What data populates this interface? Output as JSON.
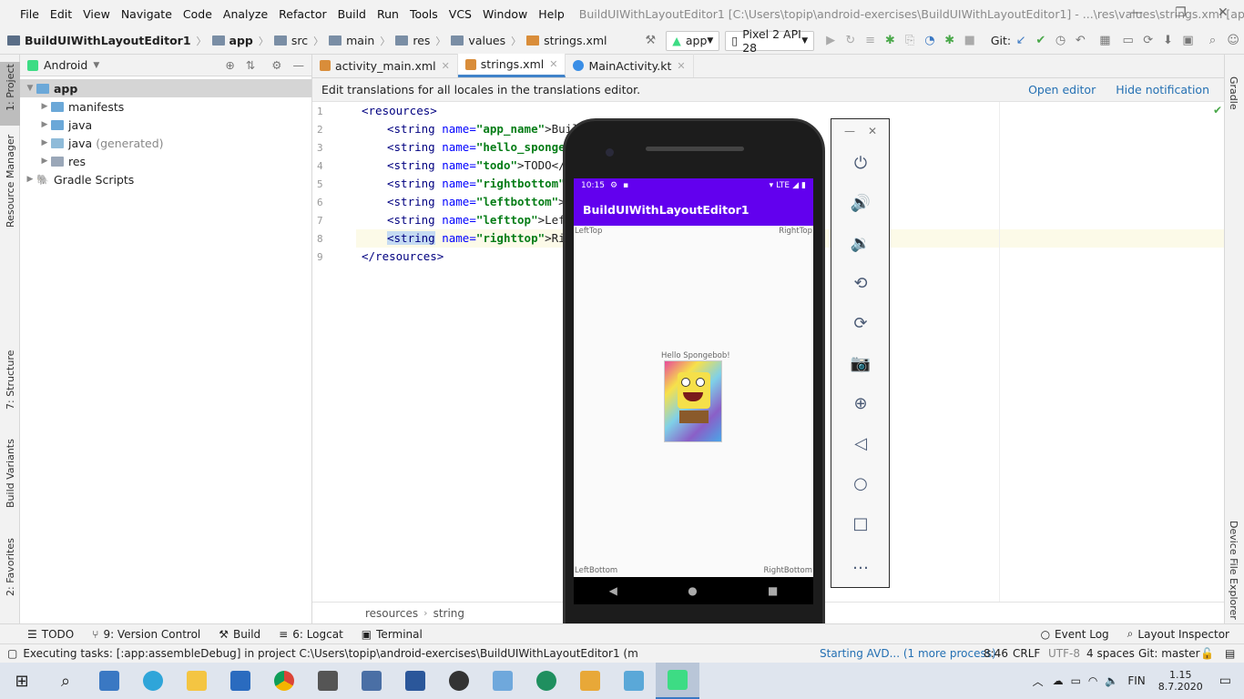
{
  "menubar": {
    "items": [
      "File",
      "Edit",
      "View",
      "Navigate",
      "Code",
      "Analyze",
      "Refactor",
      "Build",
      "Run",
      "Tools",
      "VCS",
      "Window",
      "Help"
    ],
    "window_title": "BuildUIWithLayoutEditor1 [C:\\Users\\topip\\android-exercises\\BuildUIWithLayoutEditor1] - ...\\res\\values\\strings.xml [app]"
  },
  "navbar": {
    "project": "BuildUIWithLayoutEditor1",
    "crumbs": [
      "app",
      "src",
      "main",
      "res",
      "values",
      "strings.xml"
    ],
    "run_config": "app",
    "device": "Pixel 2 API 28",
    "git_label": "Git:"
  },
  "left_strip": {
    "labels": [
      "1: Project",
      "Resource Manager",
      "7: Structure",
      "Build Variants",
      "2: Favorites"
    ]
  },
  "right_strip": {
    "labels": [
      "Gradle",
      "Device File Explorer"
    ]
  },
  "project_panel": {
    "view_mode": "Android",
    "tree": [
      {
        "label": "app",
        "depth": 0,
        "expanded": true
      },
      {
        "label": "manifests",
        "depth": 1
      },
      {
        "label": "java",
        "depth": 1
      },
      {
        "label": "java",
        "suffix": "(generated)",
        "depth": 1
      },
      {
        "label": "res",
        "depth": 1
      },
      {
        "label": "Gradle Scripts",
        "depth": 0
      }
    ]
  },
  "editor_tabs": [
    {
      "label": "activity_main.xml",
      "active": false
    },
    {
      "label": "strings.xml",
      "active": true
    },
    {
      "label": "MainActivity.kt",
      "active": false
    }
  ],
  "notification": {
    "text": "Edit translations for all locales in the translations editor.",
    "open_editor": "Open editor",
    "hide": "Hide notification"
  },
  "code": {
    "line_numbers": [
      "1",
      "2",
      "3",
      "4",
      "5",
      "6",
      "7",
      "8",
      "9"
    ],
    "lines": [
      {
        "open": "<resources>"
      },
      {
        "tag": "<string",
        "attr": "name=",
        "val": "\"app_name\"",
        "rest": ">Build"
      },
      {
        "tag": "<string",
        "attr": "name=",
        "val": "\"hello_spongebob\"",
        "rest": ""
      },
      {
        "tag": "<string",
        "attr": "name=",
        "val": "\"todo\"",
        "rest": ">TODO</st"
      },
      {
        "tag": "<string",
        "attr": "name=",
        "val": "\"rightbottom\"",
        "rest": ">R"
      },
      {
        "tag": "<string",
        "attr": "name=",
        "val": "\"leftbottom\"",
        "rest": ">Le"
      },
      {
        "tag": "<string",
        "attr": "name=",
        "val": "\"lefttop\"",
        "rest": ">LeftT"
      },
      {
        "tag": "<string",
        "attr": "name=",
        "val": "\"righttop\"",
        "rest": ">Righ"
      },
      {
        "open": "</resources>"
      }
    ],
    "breadcrumb": [
      "resources",
      "string"
    ]
  },
  "phone": {
    "time": "10:15",
    "network": "LTE",
    "app_title": "BuildUIWithLayoutEditor1",
    "left_top": "LeftTop",
    "right_top": "RightTop",
    "left_bottom": "LeftBottom",
    "right_bottom": "RightBottom",
    "hello": "Hello Spongebob!"
  },
  "bottom_tools": [
    "TODO",
    "9: Version Control",
    "Build",
    "6: Logcat",
    "Terminal"
  ],
  "bottom_tools_right": [
    "Event Log",
    "Layout Inspector"
  ],
  "status": {
    "message": "Executing tasks: [:app:assembleDebug] in project C:\\Users\\topip\\android-exercises\\BuildUIWithLayoutEditor1 (m",
    "avd": "Starting AVD... (1 more process)",
    "pos": "8:46",
    "crlf": "CRLF",
    "enc": "UTF-8",
    "indent": "4 spaces",
    "git": "Git: master"
  },
  "taskbar": {
    "lang": "FIN",
    "time": "1.15",
    "date": "8.7.2020"
  }
}
